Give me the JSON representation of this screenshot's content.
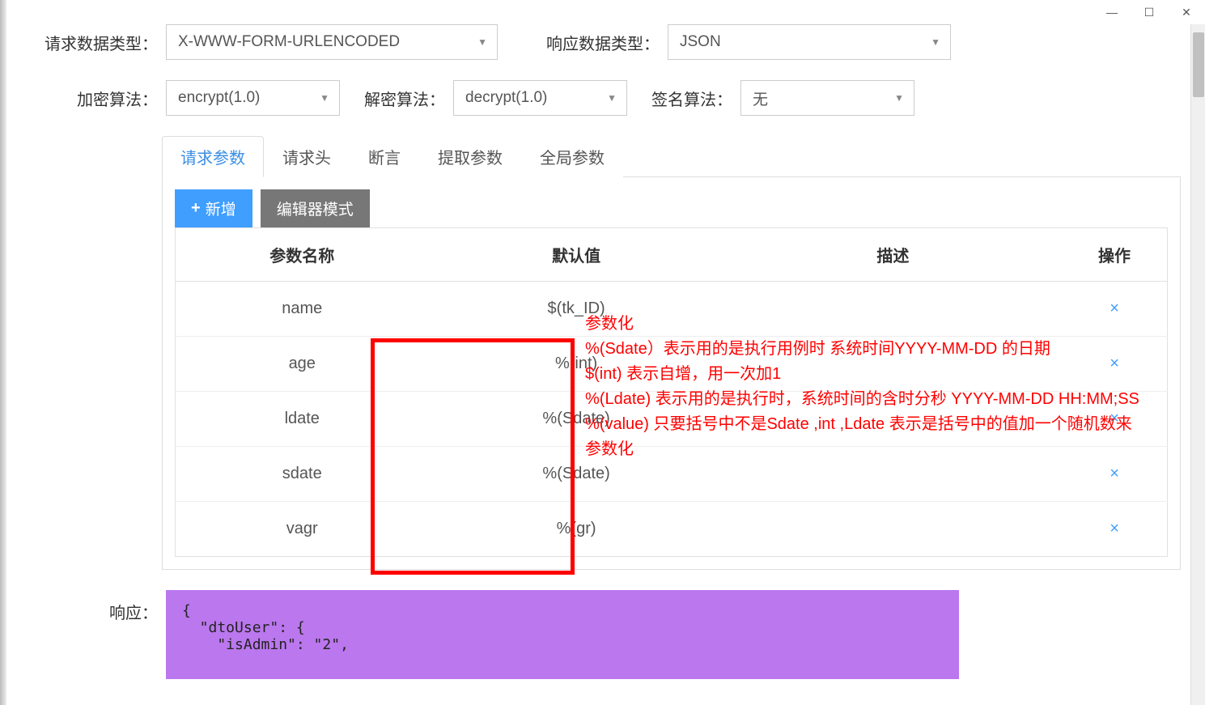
{
  "window_controls": {
    "min": "—",
    "max": "☐",
    "close": "✕"
  },
  "form1": {
    "request_type_label": "请求数据类型：",
    "request_type_value": "X-WWW-FORM-URLENCODED",
    "response_type_label": "响应数据类型：",
    "response_type_value": "JSON"
  },
  "form2": {
    "encrypt_label": "加密算法：",
    "encrypt_value": "encrypt(1.0)",
    "decrypt_label": "解密算法：",
    "decrypt_value": "decrypt(1.0)",
    "sign_label": "签名算法：",
    "sign_value": "无"
  },
  "tabs": [
    "请求参数",
    "请求头",
    "断言",
    "提取参数",
    "全局参数"
  ],
  "buttons": {
    "add": "新增",
    "editor": "编辑器模式"
  },
  "table": {
    "headers": [
      "参数名称",
      "默认值",
      "描述",
      "操作"
    ],
    "rows": [
      {
        "name": "name",
        "val": "$(tk_ID)",
        "desc": ""
      },
      {
        "name": "age",
        "val": "%(int)",
        "desc": ""
      },
      {
        "name": "ldate",
        "val": "%(Sdate)",
        "desc": ""
      },
      {
        "name": "sdate",
        "val": "%(Sdate)",
        "desc": ""
      },
      {
        "name": "vagr",
        "val": "%(gr)",
        "desc": ""
      }
    ],
    "del": "×"
  },
  "annotation": {
    "line1": "参数化",
    "line2": "%(Sdate）表示用的是执行用例时 系统时间YYYY-MM-DD 的日期",
    "line3": "$(int)  表示自增，用一次加1",
    "line4": "%(Ldate)  表示用的是执行时，系统时间的含时分秒  YYYY-MM-DD HH:MM;SS",
    "line5": "%(value)  只要括号中不是Sdate ,int ,Ldate 表示是括号中的值加一个随机数来参数化"
  },
  "response": {
    "label": "响应：",
    "body": "{\n  \"dtoUser\": {\n    \"isAdmin\": \"2\","
  }
}
